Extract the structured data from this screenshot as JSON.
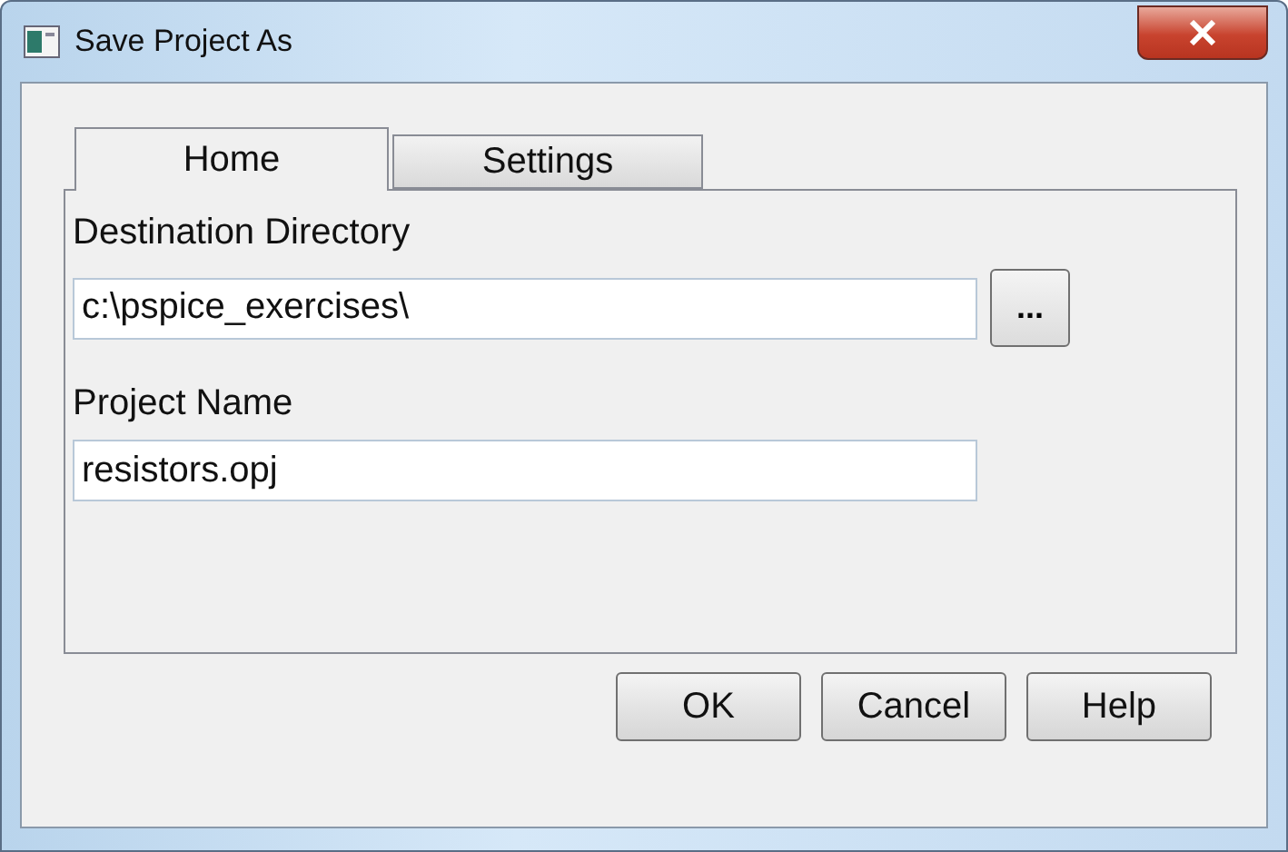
{
  "window": {
    "title": "Save Project As"
  },
  "tabs": [
    {
      "label": "Home",
      "selected": true
    },
    {
      "label": "Settings",
      "selected": false
    }
  ],
  "fields": [
    {
      "label": "Destination Directory",
      "value": "c:\\pspice_exercises\\",
      "browse": "..."
    },
    {
      "label": "Project Name",
      "value": "resistors.opj"
    }
  ],
  "buttons": [
    "OK",
    "Cancel",
    "Help"
  ]
}
